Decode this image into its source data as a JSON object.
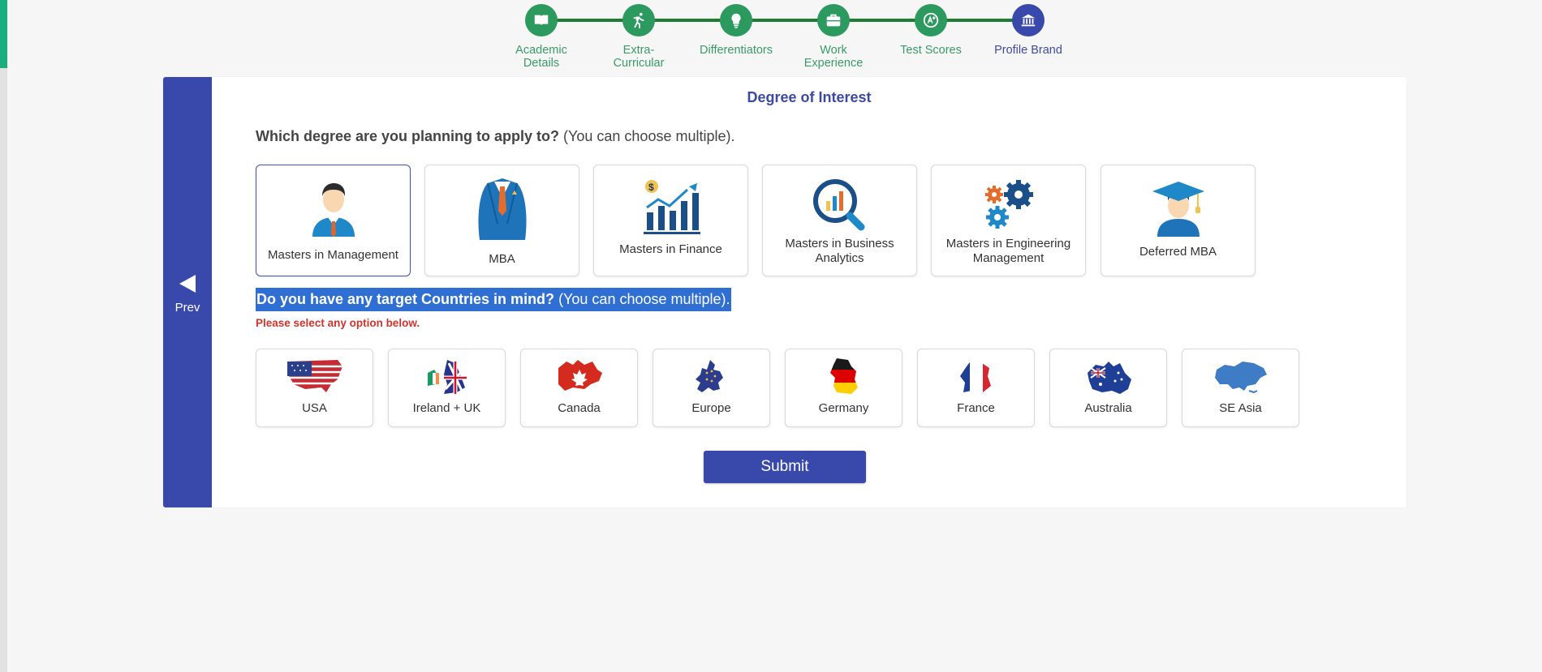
{
  "colors": {
    "primary": "#3949ab",
    "step_done": "#2c9a5f",
    "step_line": "#1f7d31",
    "warning": "#d0342c",
    "highlight": "#2f6fd3"
  },
  "stepper": {
    "steps": [
      {
        "label": "Academic Details",
        "icon": "book-icon"
      },
      {
        "label": "Extra-Curricular",
        "icon": "runner-icon"
      },
      {
        "label": "Differentiators",
        "icon": "lightbulb-icon"
      },
      {
        "label": "Work Experience",
        "icon": "briefcase-icon"
      },
      {
        "label": "Test Scores",
        "icon": "score-icon"
      },
      {
        "label": "Profile Brand",
        "icon": "bank-icon"
      }
    ],
    "active_index": 5
  },
  "nav": {
    "prev_label": "Prev"
  },
  "page": {
    "title": "Degree of Interest",
    "degree_question": {
      "bold": "Which degree are you planning to apply to?",
      "note": " (You can choose multiple)."
    },
    "country_question": {
      "bold": "Do you have any target Countries in mind?",
      "note": " (You can choose multiple)."
    },
    "warning": "Please select any option below."
  },
  "degrees": [
    {
      "label": "Masters in Management",
      "icon": "manager-icon",
      "selected": true
    },
    {
      "label": "MBA",
      "icon": "suit-icon",
      "selected": false
    },
    {
      "label": "Masters in Finance",
      "icon": "growth-chart-icon",
      "selected": false
    },
    {
      "label": "Masters in Business Analytics",
      "icon": "analytics-magnifier-icon",
      "selected": false
    },
    {
      "label": "Masters in Engineering Management",
      "icon": "gears-icon",
      "selected": false
    },
    {
      "label": "Deferred MBA",
      "icon": "graduate-icon",
      "selected": false
    }
  ],
  "countries": [
    {
      "label": "USA",
      "icon": "usa-flag-map-icon"
    },
    {
      "label": "Ireland + UK",
      "icon": "ireland-uk-flag-map-icon"
    },
    {
      "label": "Canada",
      "icon": "canada-map-icon"
    },
    {
      "label": "Europe",
      "icon": "europe-map-icon"
    },
    {
      "label": "Germany",
      "icon": "germany-map-icon"
    },
    {
      "label": "France",
      "icon": "france-map-icon"
    },
    {
      "label": "Australia",
      "icon": "australia-map-icon"
    },
    {
      "label": "SE Asia",
      "icon": "se-asia-map-icon"
    }
  ],
  "submit_label": "Submit"
}
